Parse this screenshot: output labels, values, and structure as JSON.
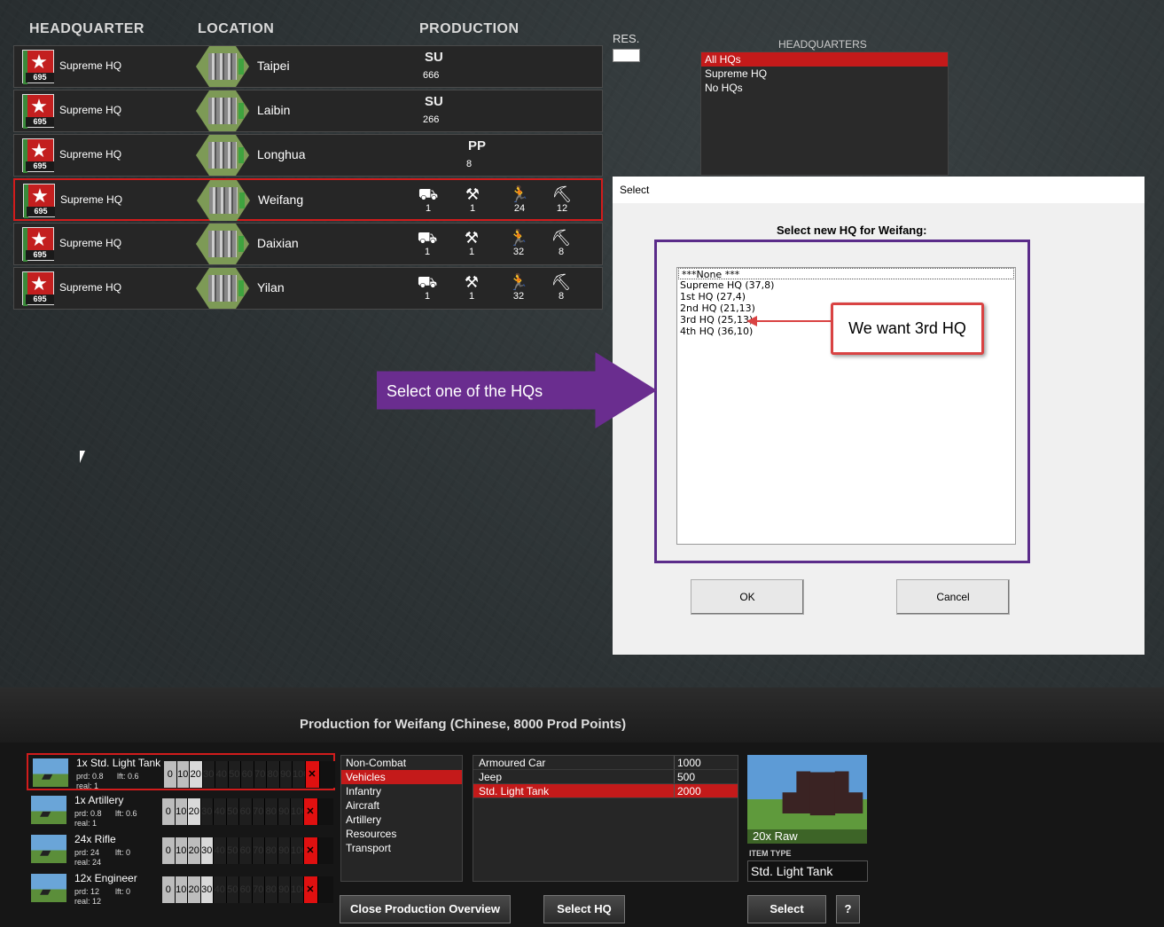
{
  "columns": {
    "headquarter": "HEADQUARTER",
    "location": "LOCATION",
    "production": "PRODUCTION"
  },
  "rows": [
    {
      "hq": "Supreme HQ",
      "badge": "695",
      "location": "Taipei",
      "prod_label": "SU",
      "prod_value": "666"
    },
    {
      "hq": "Supreme HQ",
      "badge": "695",
      "location": "Laibin",
      "prod_label": "SU",
      "prod_value": "266"
    },
    {
      "hq": "Supreme HQ",
      "badge": "695",
      "location": "Longhua",
      "prod_label": "PP",
      "prod_value": "8"
    },
    {
      "hq": "Supreme HQ",
      "badge": "695",
      "location": "Weifang",
      "units": [
        "1",
        "1",
        "24",
        "12"
      ]
    },
    {
      "hq": "Supreme HQ",
      "badge": "695",
      "location": "Daixian",
      "units": [
        "1",
        "1",
        "32",
        "8"
      ]
    },
    {
      "hq": "Supreme HQ",
      "badge": "695",
      "location": "Yilan",
      "units": [
        "1",
        "1",
        "32",
        "8"
      ]
    }
  ],
  "res_label": "RES.",
  "hq_filter": {
    "title": "HEADQUARTERS",
    "items": [
      "All HQs",
      "Supreme HQ",
      "No HQs"
    ]
  },
  "dialog": {
    "title": "Select",
    "prompt": "Select new HQ for Weifang:",
    "options": [
      "***None ***",
      "Supreme HQ (37,8)",
      "1st HQ (27,4)",
      "2nd HQ (21,13)",
      "3rd HQ (25,13)",
      "4th HQ (36,10)"
    ],
    "ok": "OK",
    "cancel": "Cancel"
  },
  "callout": "We want 3rd HQ",
  "hint": "Select one of the HQs",
  "production": {
    "title": "Production for Weifang (Chinese, 8000 Prod Points)",
    "queue": [
      {
        "name": "1x Std. Light Tank",
        "prd": "prd: 0.8",
        "lft": "lft: 0.6",
        "real": "real: 1"
      },
      {
        "name": "1x Artillery",
        "prd": "prd: 0.8",
        "lft": "lft: 0.6",
        "real": "real: 1"
      },
      {
        "name": "24x Rifle",
        "prd": "prd: 24",
        "lft": "lft: 0",
        "real": "real: 24"
      },
      {
        "name": "12x Engineer",
        "prd": "prd: 12",
        "lft": "lft: 0",
        "real": "real: 12"
      }
    ],
    "bar_labels": [
      "0",
      "10",
      "20",
      "30",
      "40",
      "50",
      "60",
      "70",
      "80",
      "90",
      "100"
    ],
    "categories": [
      "Non-Combat",
      "Vehicles",
      "Infantry",
      "Aircraft",
      "Artillery",
      "Resources",
      "Transport"
    ],
    "items": [
      {
        "name": "Armoured Car",
        "cost": "1000"
      },
      {
        "name": "Jeep",
        "cost": "500"
      },
      {
        "name": "Std. Light Tank",
        "cost": "2000"
      }
    ],
    "preview_caption": "20x Raw",
    "item_type_label": "ITEM TYPE",
    "item_type": "Std. Light Tank",
    "buttons": {
      "close": "Close Production Overview",
      "select_hq": "Select HQ",
      "select": "Select",
      "help": "?"
    }
  },
  "colors": {
    "accent_red": "#c41a1a",
    "callout_border": "#d94343",
    "purple": "#6a2d8f"
  }
}
